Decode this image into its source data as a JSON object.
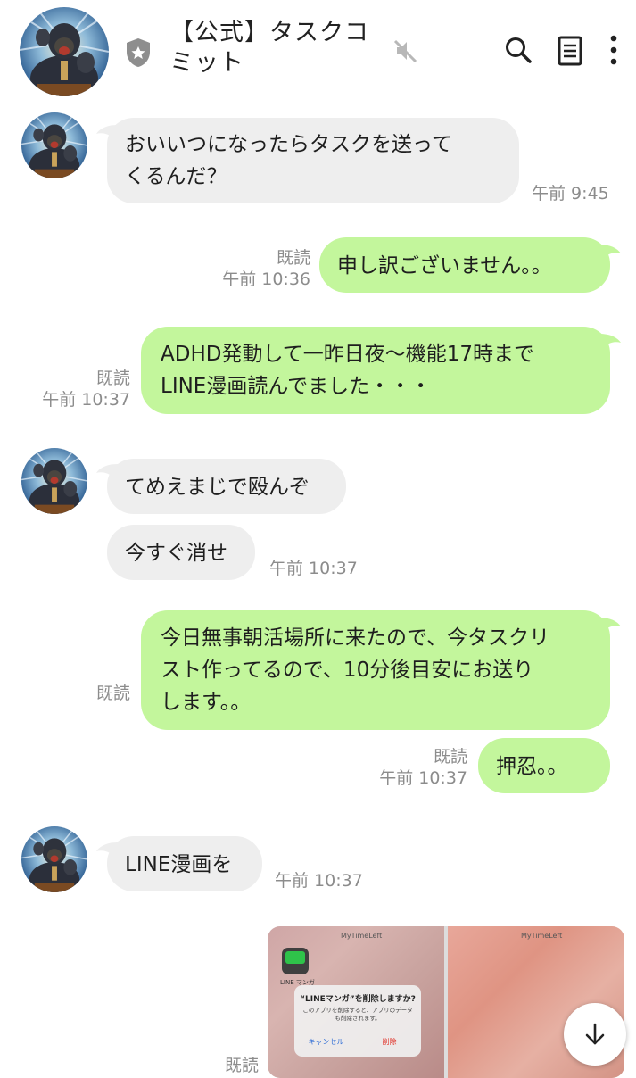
{
  "header": {
    "title": "【公式】タスクコミット",
    "icons": [
      "gorilla-avatar",
      "shield-star-icon",
      "mute-icon",
      "search-icon",
      "notes-icon",
      "more-icon"
    ]
  },
  "messages": [
    {
      "side": "in",
      "text": "おいいつになったらタスクを送ってくるんだ？",
      "lines": [
        "おいいつになったらタスクを送って",
        "くるんだ？"
      ],
      "time": "午前 9:45"
    },
    {
      "side": "out",
      "text": "申し訳ございません。。",
      "read": "既読",
      "time": "午前 10:36"
    },
    {
      "side": "out",
      "text": "ADHD発動して一昨日夜〜機能17時までLINE漫画読んでました・・・",
      "lines": [
        "ADHD発動して一昨日夜〜機能17時まで",
        "LINE漫画読んでました・・・"
      ],
      "read": "既読",
      "time": "午前 10:37"
    },
    {
      "side": "in",
      "text": "てめえまじで殴んぞ"
    },
    {
      "side": "in",
      "text": "今すぐ消せ",
      "time": "午前 10:37"
    },
    {
      "side": "out",
      "text": "今日無事朝活場所に来たので、今タスクリスト作ってるので、10分後目安にお送りします。。",
      "lines": [
        "今日無事朝活場所に来たので、今タスクリ",
        "スト作ってるので、10分後目安にお送り",
        "します。。"
      ],
      "read": "既読"
    },
    {
      "side": "out",
      "text": "押忍。。",
      "read": "既読",
      "time": "午前 10:37"
    },
    {
      "side": "in",
      "text": "LINE漫画を",
      "time": "午前 10:37"
    },
    {
      "side": "out",
      "type": "image",
      "read": "既読"
    }
  ],
  "image_message": {
    "caption_left": "MyTimeLeft",
    "caption_right": "MyTimeLeft",
    "app_name": "LINE マンガ",
    "dialog_title": "“LINEマンガ”を削除しますか?",
    "dialog_body": "このアプリを削除すると、アプリのデータも削除されます。",
    "cancel": "キャンセル",
    "delete": "削除"
  },
  "colors": {
    "incoming_bubble": "#eeeeee",
    "outgoing_bubble": "#c3f69c",
    "meta_text": "#8c8c8c",
    "background": "#ffffff"
  },
  "scroll_button_icon": "arrow-down-icon"
}
